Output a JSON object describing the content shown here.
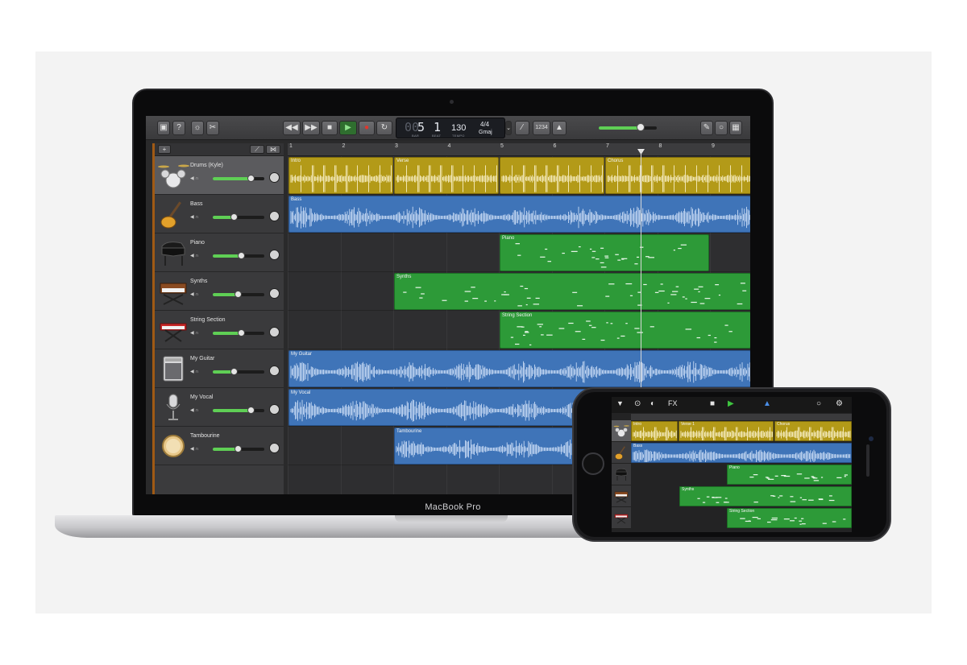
{
  "device": {
    "laptop_label": "MacBook Pro"
  },
  "toolbar": {
    "lcd": {
      "bar_value": "5",
      "beat_value": "1",
      "tempo": "130",
      "time_signature": "4/4",
      "key": "Gmaj",
      "bar_caption": "BAR",
      "beat_caption": "BEAT",
      "tempo_caption": "TEMPO"
    },
    "count_in": "1234",
    "master_volume": 0.72
  },
  "ruler": [
    "1",
    "2",
    "3",
    "4",
    "5",
    "6",
    "7",
    "8",
    "9"
  ],
  "tracks": [
    {
      "name": "Drums (Kyle)",
      "icon": "drum-kit-icon",
      "volume": 0.74,
      "selected": true
    },
    {
      "name": "Bass",
      "icon": "bass-guitar-icon",
      "volume": 0.4,
      "selected": false
    },
    {
      "name": "Piano",
      "icon": "grand-piano-icon",
      "volume": 0.55,
      "selected": false
    },
    {
      "name": "Synths",
      "icon": "synth-keyboard-icon",
      "volume": 0.48,
      "selected": false
    },
    {
      "name": "String Section",
      "icon": "keyboard-stand-icon",
      "volume": 0.55,
      "selected": false
    },
    {
      "name": "My Guitar",
      "icon": "guitar-amp-icon",
      "volume": 0.4,
      "selected": false
    },
    {
      "name": "My Vocal",
      "icon": "microphone-icon",
      "volume": 0.74,
      "selected": false
    },
    {
      "name": "Tambourine",
      "icon": "tambourine-icon",
      "volume": 0.48,
      "selected": false
    }
  ],
  "regions": [
    {
      "label": "Intro",
      "lane": 0,
      "kind": "drum"
    },
    {
      "label": "Verse",
      "lane": 0,
      "kind": "drum"
    },
    {
      "label": "",
      "lane": 0,
      "kind": "drum"
    },
    {
      "label": "Chorus",
      "lane": 0,
      "kind": "drum"
    },
    {
      "label": "Bass",
      "lane": 1,
      "kind": "audio"
    },
    {
      "label": "Piano",
      "lane": 2,
      "kind": "midi"
    },
    {
      "label": "Synths",
      "lane": 3,
      "kind": "midi"
    },
    {
      "label": "String Section",
      "lane": 4,
      "kind": "midi"
    },
    {
      "label": "My Guitar",
      "lane": 5,
      "kind": "audio"
    },
    {
      "label": "My Vocal",
      "lane": 6,
      "kind": "audio"
    },
    {
      "label": "Tambourine",
      "lane": 7,
      "kind": "audio"
    }
  ],
  "phone": {
    "fx_label": "FX",
    "regions": [
      {
        "label": "Intro",
        "kind": "drum"
      },
      {
        "label": "Verse 1",
        "kind": "drum"
      },
      {
        "label": "Chorus",
        "kind": "drum"
      },
      {
        "label": "Bass",
        "kind": "audio"
      },
      {
        "label": "Piano",
        "kind": "midi"
      },
      {
        "label": "Synths",
        "kind": "midi"
      },
      {
        "label": "String Section",
        "kind": "midi"
      }
    ]
  },
  "colors": {
    "drum_region": "#b39a18",
    "audio_region": "#3f74b8",
    "midi_region": "#2d9a38",
    "volume_green": "#5fcf55",
    "record_red": "#e0362c",
    "play_green": "#3ec43f"
  }
}
